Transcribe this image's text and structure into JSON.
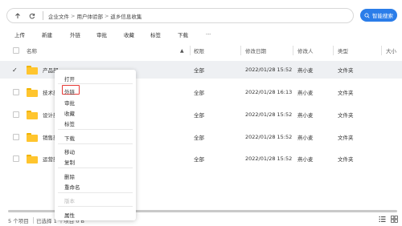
{
  "addressbar": {
    "back_icon": "arrow-up-icon",
    "refresh_icon": "refresh-icon",
    "breadcrumbs": [
      "企业文件",
      "用户体验部",
      "返乡信息收集"
    ]
  },
  "search": {
    "label": "智能搜索",
    "icon": "search-icon"
  },
  "toolbar": {
    "upload": "上传",
    "new": "新建",
    "link": "外链",
    "approve": "审批",
    "favorite": "收藏",
    "tag": "标签",
    "download": "下载",
    "more": "···"
  },
  "table": {
    "headers": {
      "name": "名称",
      "permission": "权限",
      "modified": "修改日期",
      "modifier": "修改人",
      "type": "类型",
      "size": "大小"
    },
    "rows": [
      {
        "name": "产品部",
        "permission": "全部",
        "modified": "2022/01/28 15:52",
        "modifier": "燕小麦",
        "type": "文件夹"
      },
      {
        "name": "技术部",
        "permission": "全部",
        "modified": "2022/01/28 16:13",
        "modifier": "燕小麦",
        "type": "文件夹"
      },
      {
        "name": "设计部",
        "permission": "全部",
        "modified": "2022/01/28 15:52",
        "modifier": "燕小麦",
        "type": "文件夹"
      },
      {
        "name": "销售部",
        "permission": "全部",
        "modified": "2022/01/28 15:52",
        "modifier": "燕小麦",
        "type": "文件夹"
      },
      {
        "name": "运营部",
        "permission": "全部",
        "modified": "2022/01/28 15:52",
        "modifier": "燕小麦",
        "type": "文件夹"
      }
    ]
  },
  "context_menu": {
    "open": "打开",
    "link": "外链",
    "approve": "审批",
    "favorite": "收藏",
    "tag": "标签",
    "download": "下载",
    "move": "移动",
    "copy": "复制",
    "delete": "删除",
    "rename": "重命名",
    "version": "版本",
    "properties": "属性"
  },
  "status": {
    "count": "5 个项目",
    "selected": "已选择 1 个项目 0 B"
  },
  "colors": {
    "accent": "#2b7de9",
    "folder": "#ffc52e",
    "highlight": "#e53935"
  }
}
